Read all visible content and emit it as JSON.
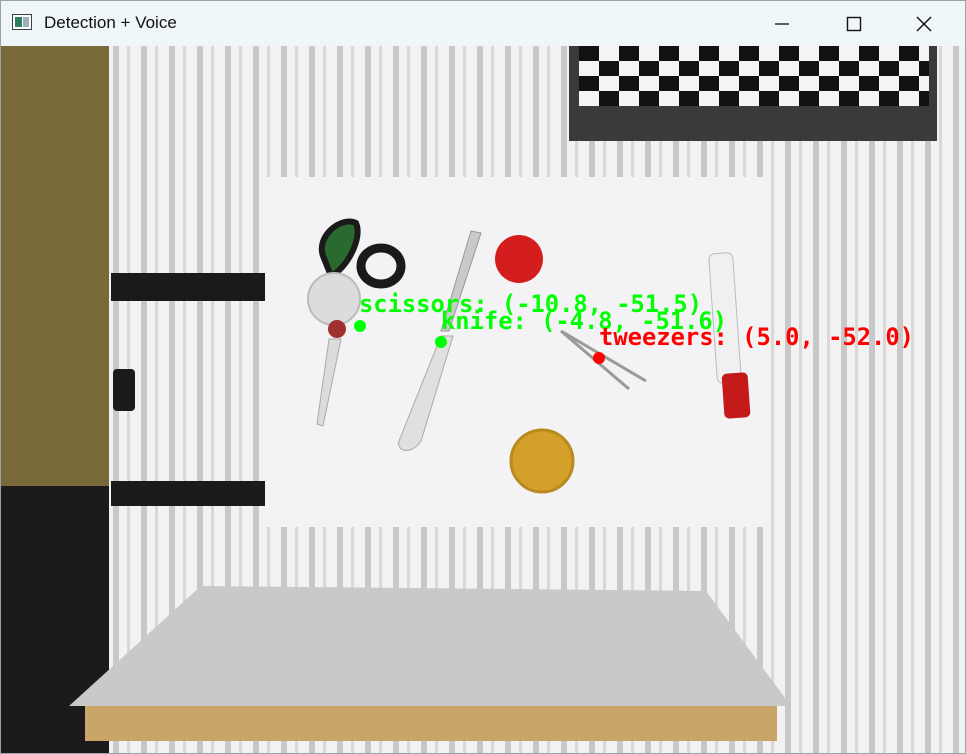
{
  "window": {
    "title": "Detection + Voice",
    "controls": {
      "minimize": "minimize-icon",
      "maximize": "maximize-icon",
      "close": "close-icon"
    }
  },
  "detections": [
    {
      "label": "scissors: (-10.8, -51.5)",
      "color": "#00ff00"
    },
    {
      "label": "knife: (-4.8, -51.6)",
      "color": "#00ff00"
    },
    {
      "label": "tweezers: (5.0, -52.0)",
      "color": "#ff0000"
    }
  ],
  "colors": {
    "green": "#00ff00",
    "red": "#ff0000",
    "titlebar": "#eef6f9"
  }
}
